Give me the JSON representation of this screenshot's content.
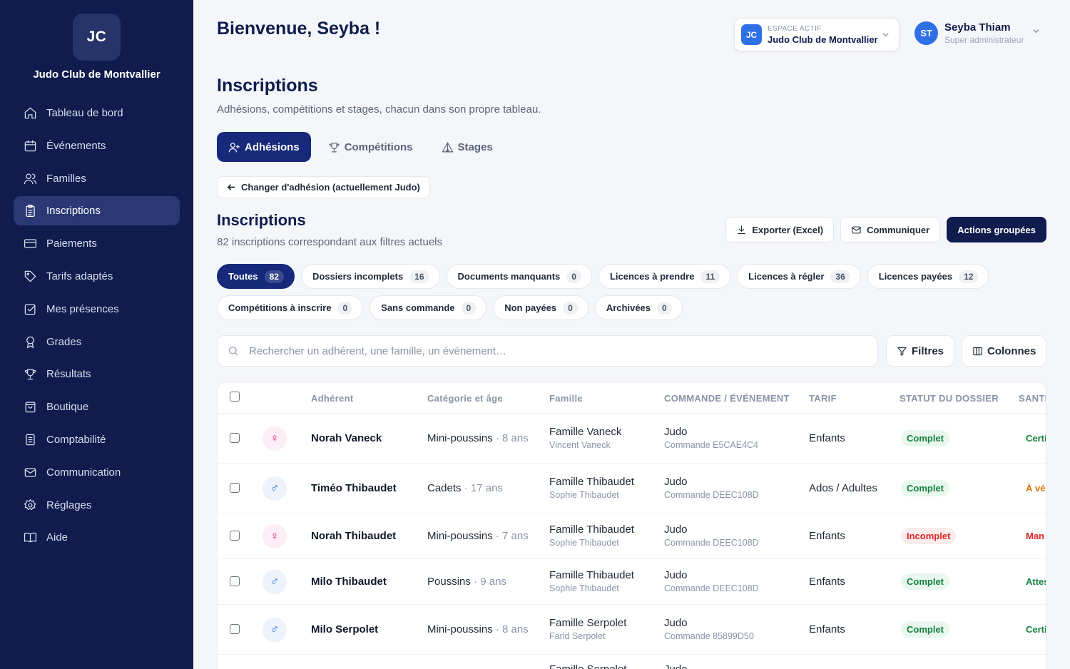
{
  "sidebar": {
    "logo": "JC",
    "org_name": "Judo Club de Montvallier",
    "items": [
      {
        "label": "Tableau de bord",
        "icon": "home-icon"
      },
      {
        "label": "Événements",
        "icon": "calendar-icon"
      },
      {
        "label": "Familles",
        "icon": "users-icon"
      },
      {
        "label": "Inscriptions",
        "icon": "clipboard-icon",
        "active": true
      },
      {
        "label": "Paiements",
        "icon": "credit-card-icon"
      },
      {
        "label": "Tarifs adaptés",
        "icon": "tag-icon"
      },
      {
        "label": "Mes présences",
        "icon": "checkbox-icon"
      },
      {
        "label": "Grades",
        "icon": "award-icon"
      },
      {
        "label": "Résultats",
        "icon": "trophy-icon"
      },
      {
        "label": "Boutique",
        "icon": "shopping-bag-icon"
      },
      {
        "label": "Comptabilité",
        "icon": "ledger-icon"
      },
      {
        "label": "Communication",
        "icon": "mail-icon"
      },
      {
        "label": "Réglages",
        "icon": "gear-icon"
      },
      {
        "label": "Aide",
        "icon": "book-icon"
      }
    ]
  },
  "header": {
    "greeting": "Bienvenue, Seyba !",
    "space": {
      "badge": "JC",
      "label": "ESPACE ACTIF",
      "name": "Judo Club de Montvallier"
    },
    "user": {
      "initials": "ST",
      "name": "Seyba Thiam",
      "role": "Super administrateur"
    }
  },
  "page": {
    "title": "Inscriptions",
    "subtitle": "Adhésions, compétitions et stages, chacun dans son propre tableau.",
    "tabs": [
      {
        "label": "Adhésions",
        "active": true
      },
      {
        "label": "Compétitions"
      },
      {
        "label": "Stages"
      }
    ],
    "change_button": "Changer d'adhésion (actuellement Judo)"
  },
  "section": {
    "title": "Inscriptions",
    "subtitle": "82 inscriptions correspondant aux filtres actuels",
    "actions": {
      "export": "Exporter (Excel)",
      "communicate": "Communiquer",
      "grouped": "Actions groupées"
    }
  },
  "filters": {
    "row1": [
      {
        "label": "Toutes",
        "count": "82",
        "active": true
      },
      {
        "label": "Dossiers incomplets",
        "count": "16"
      },
      {
        "label": "Documents manquants",
        "count": "0"
      },
      {
        "label": "Licences à prendre",
        "count": "11"
      },
      {
        "label": "Licences à régler",
        "count": "36"
      },
      {
        "label": "Licences payées",
        "count": "12"
      }
    ],
    "row2": [
      {
        "label": "Compétitions à inscrire",
        "count": "0"
      },
      {
        "label": "Sans commande",
        "count": "0"
      },
      {
        "label": "Non payées",
        "count": "0"
      },
      {
        "label": "Archivées",
        "count": "0"
      }
    ]
  },
  "search": {
    "placeholder": "Rechercher un adhérent, une famille, un événement…",
    "value": ""
  },
  "toolbar": {
    "filters": "Filtres",
    "columns": "Colonnes"
  },
  "table": {
    "headers": {
      "member": "Adhérent",
      "category": "Catégorie et âge",
      "family": "Famille",
      "order": "COMMANDE / ÉVÉNEMENT",
      "tarif": "TARIF",
      "status": "STATUT DU DOSSIER",
      "sante": "SANTI"
    },
    "rows": [
      {
        "gender": "♀",
        "gender_type": "f",
        "name": "Norah Vaneck",
        "category": "Mini-poussins",
        "age": "8 ans",
        "family": "Famille Vaneck",
        "family_contact": "Vincent Vaneck",
        "event": "Judo",
        "order": "Commande E5CAE4C4",
        "tarif": "Enfants",
        "status": "Complet",
        "status_type": "ok",
        "sante": "Certi",
        "sante_color": "#15803d"
      },
      {
        "gender": "♂",
        "gender_type": "m",
        "name": "Timéo Thibaudet",
        "category": "Cadets",
        "age": "17 ans",
        "family": "Famille Thibaudet",
        "family_contact": "Sophie Thibaudet",
        "event": "Judo",
        "order": "Commande DEEC108D",
        "tarif": "Ados / Adultes",
        "status": "Complet",
        "status_type": "ok",
        "sante": "À vé",
        "sante_color": "#d97706"
      },
      {
        "gender": "♀",
        "gender_type": "f",
        "name": "Norah Thibaudet",
        "category": "Mini-poussins",
        "age": "7 ans",
        "family": "Famille Thibaudet",
        "family_contact": "Sophie Thibaudet",
        "event": "Judo",
        "order": "Commande DEEC108D",
        "tarif": "Enfants",
        "status": "Incomplet",
        "status_type": "ko",
        "sante": "Man",
        "sante_color": "#dc2626"
      },
      {
        "gender": "♂",
        "gender_type": "m",
        "name": "Milo Thibaudet",
        "category": "Poussins",
        "age": "9 ans",
        "family": "Famille Thibaudet",
        "family_contact": "Sophie Thibaudet",
        "event": "Judo",
        "order": "Commande DEEC108D",
        "tarif": "Enfants",
        "status": "Complet",
        "status_type": "ok",
        "sante": "Attes",
        "sante_color": "#15803d"
      },
      {
        "gender": "♂",
        "gender_type": "m",
        "name": "Milo Serpolet",
        "category": "Mini-poussins",
        "age": "8 ans",
        "family": "Famille Serpolet",
        "family_contact": "Farid Serpolet",
        "event": "Judo",
        "order": "Commande 85899D50",
        "tarif": "Enfants",
        "status": "Complet",
        "status_type": "ok",
        "sante": "Certi",
        "sante_color": "#15803d"
      }
    ],
    "partial_row": {
      "family": "Famille Serpolet",
      "event": "Judo"
    }
  }
}
